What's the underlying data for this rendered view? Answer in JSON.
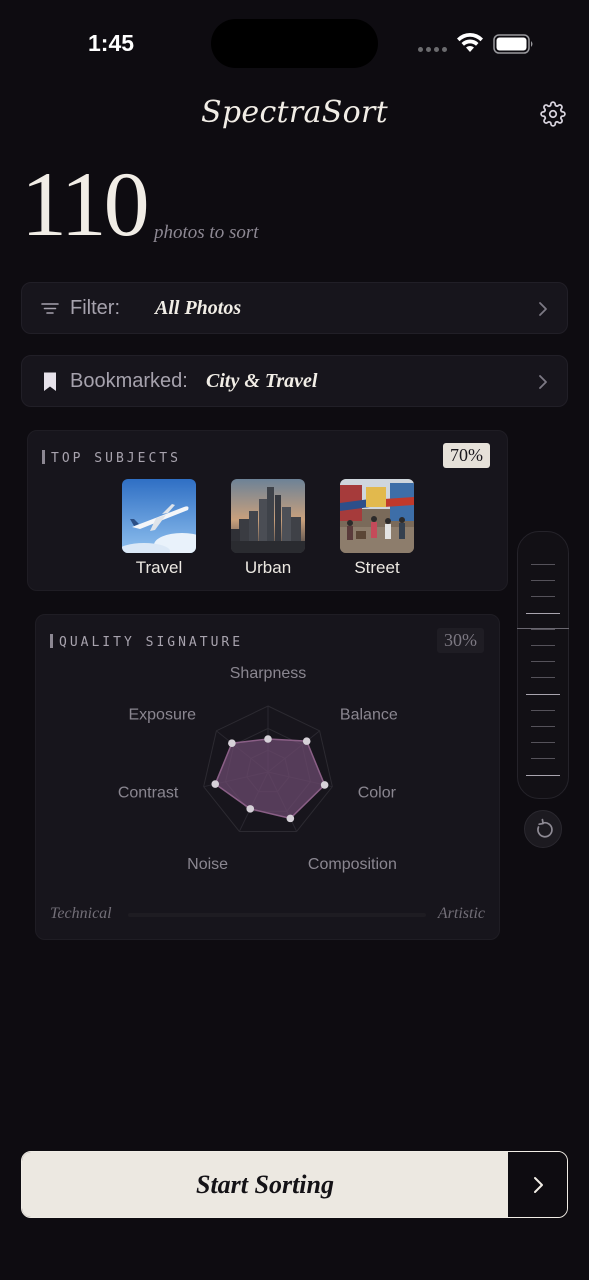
{
  "status": {
    "time": "1:45"
  },
  "header": {
    "title": "SpectraSort",
    "settings_icon": "gear-icon"
  },
  "count": {
    "number": "110",
    "label": "photos to sort"
  },
  "filter": {
    "label": "Filter:",
    "value": "All Photos",
    "icon": "filter-lines-icon"
  },
  "bookmarked": {
    "label": "Bookmarked:",
    "value": "City & Travel",
    "icon": "bookmark-icon"
  },
  "top_subjects": {
    "title": "TOP SUBJECTS",
    "percent": "70%",
    "items": [
      {
        "label": "Travel",
        "icon": "airplane-photo"
      },
      {
        "label": "Urban",
        "icon": "skyline-photo"
      },
      {
        "label": "Street",
        "icon": "street-photo"
      }
    ]
  },
  "quality": {
    "title": "QUALITY SIGNATURE",
    "percent": "30%",
    "axes": [
      "Sharpness",
      "Balance",
      "Color",
      "Composition",
      "Noise",
      "Contrast",
      "Exposure"
    ],
    "values": [
      0.5,
      0.75,
      0.88,
      0.78,
      0.62,
      0.82,
      0.7
    ],
    "spectrum_left": "Technical",
    "spectrum_right": "Artistic"
  },
  "slider": {
    "level": 0.3
  },
  "cta": {
    "label": "Start Sorting",
    "icon": "chevron-right-icon"
  }
}
